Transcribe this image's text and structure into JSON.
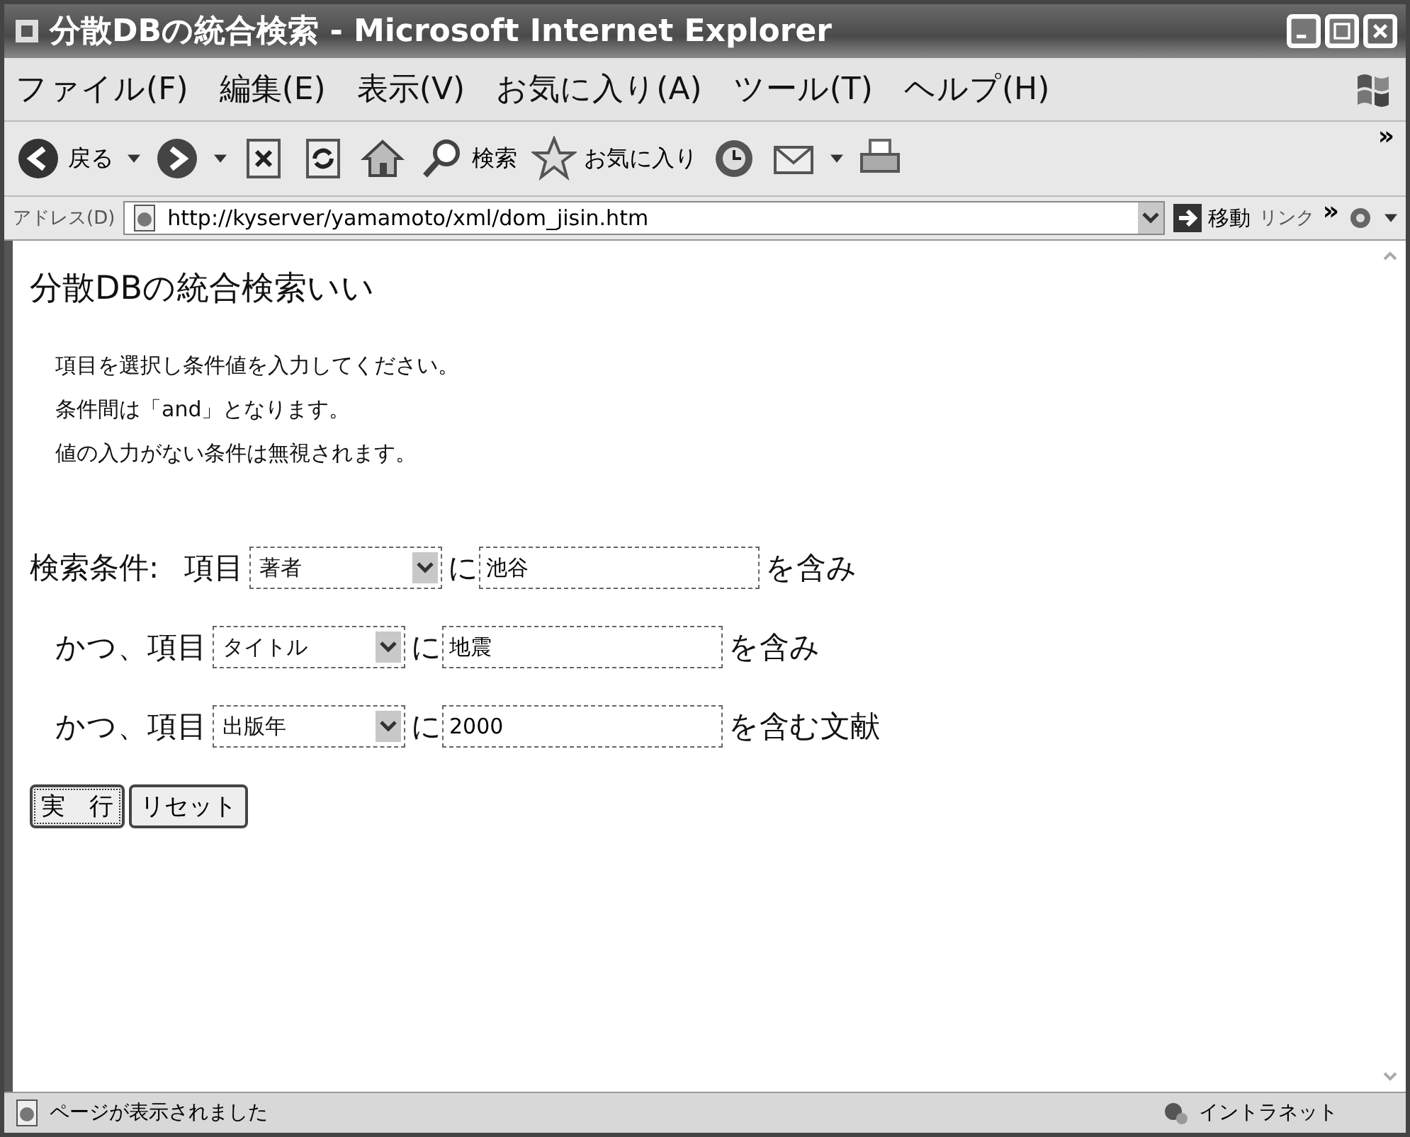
{
  "window": {
    "title": "分散DBの統合検索 - Microsoft Internet Explorer"
  },
  "menu": [
    "ファイル(F)",
    "編集(E)",
    "表示(V)",
    "お気に入り(A)",
    "ツール(T)",
    "ヘルプ(H)"
  ],
  "toolbar": {
    "back": "戻る",
    "search": "検索",
    "favorites": "お気に入り",
    "more": "»"
  },
  "address_bar": {
    "label": "アドレス(D)",
    "url": "http://kyserver/yamamoto/xml/dom_jisin.htm",
    "go": "移動",
    "links": "リンク",
    "more": "»"
  },
  "page": {
    "heading": "分散DBの統合検索いい",
    "instructions": [
      "項目を選択し条件値を入力してください。",
      "条件間は「and」となります。",
      "値の入力がない条件は無視されます。"
    ],
    "conditions": [
      {
        "prefix": "検索条件:",
        "label": "項目",
        "field": "著者",
        "particle": "に",
        "value": "池谷",
        "suffix": "を含み"
      },
      {
        "label": "かつ、項目",
        "field": "タイトル",
        "particle": "に",
        "value": "地震",
        "suffix": "を含み"
      },
      {
        "label": "かつ、項目",
        "field": "出版年",
        "particle": "に",
        "value": "2000",
        "suffix": "を含む文献"
      }
    ],
    "buttons": [
      "実　行",
      "リセット"
    ]
  },
  "status_bar": {
    "text": "ページが表示されました",
    "zone": "イントラネット"
  }
}
